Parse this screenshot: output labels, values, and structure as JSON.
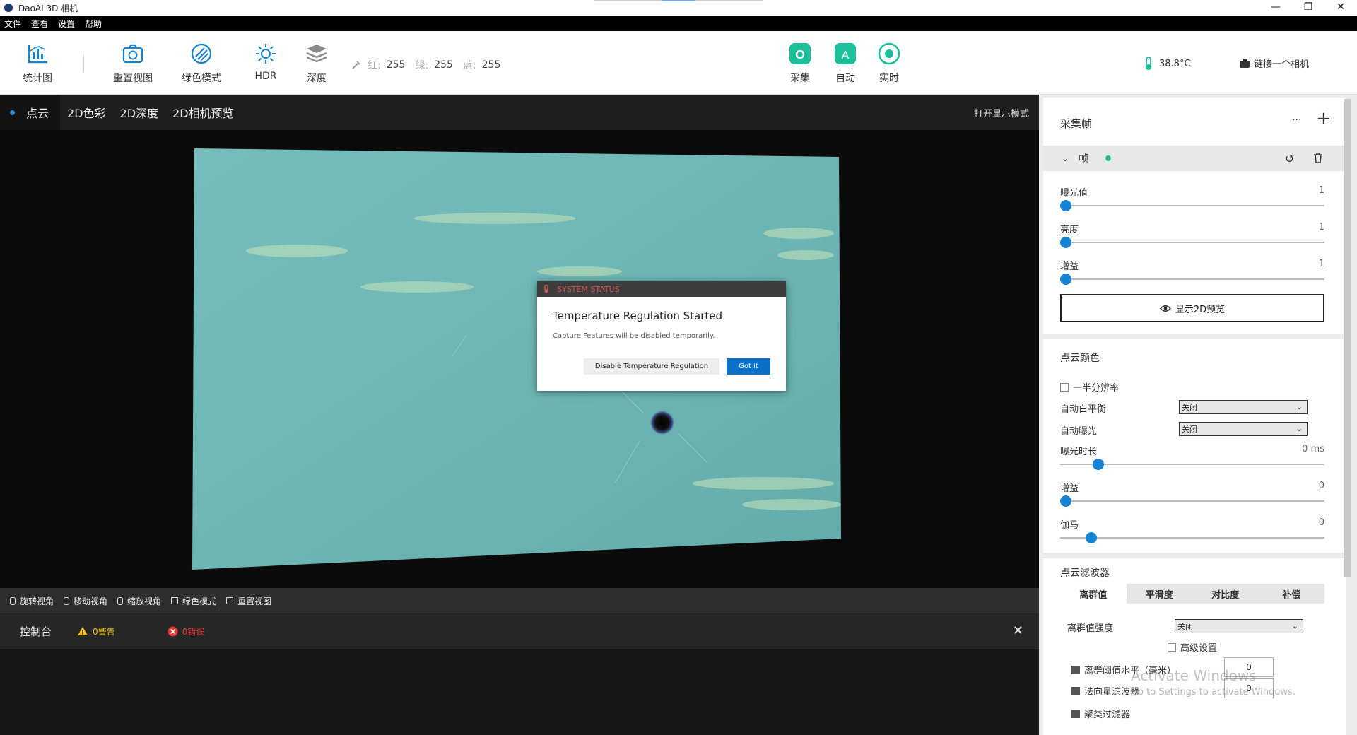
{
  "window": {
    "title": "DaoAI 3D 相机",
    "controls": [
      "—",
      "❐",
      "✕"
    ]
  },
  "menu": [
    "文件",
    "查看",
    "设置",
    "帮助"
  ],
  "toolbar": {
    "stats": "统计图",
    "reset_view": "重置视图",
    "green_mode": "绿色模式",
    "hdr": "HDR",
    "depth": "深度",
    "rgb": {
      "r_label": "红:",
      "r": "255",
      "g_label": "绿:",
      "g": "255",
      "b_label": "蓝:",
      "b": "255"
    },
    "capture": "采集",
    "auto": "自动",
    "auto_letter": "A",
    "realtime": "实时",
    "temperature": "38.8°C",
    "connect_camera": "链接一个相机",
    "accent": "#1bbf9a",
    "blue": "#1583d1"
  },
  "view": {
    "tabs": [
      "点云",
      "2D色彩",
      "2D深度",
      "2D相机预览"
    ],
    "open_display": "打开显示模式"
  },
  "dialog": {
    "header": "SYSTEM STATUS",
    "title": "Temperature Regulation Started",
    "message": "Capture Features will be disabled temporarily.",
    "secondary": "Disable Temperature Regulation",
    "primary": "Got it"
  },
  "hints": [
    "旋转视角",
    "移动视角",
    "缩放视角",
    "绿色模式",
    "重置视图"
  ],
  "console": {
    "title": "控制台",
    "warnings": "0警告",
    "errors": "0错误"
  },
  "panel": {
    "title": "采集帧",
    "more": "···",
    "add": "+",
    "frame_label": "帧",
    "exposure": {
      "label": "曝光值",
      "value": "1"
    },
    "brightness": {
      "label": "亮度",
      "value": "1"
    },
    "gain": {
      "label": "增益",
      "value": "1"
    },
    "preview_2d": "显示2D预览",
    "cloud_color": {
      "title": "点云颜色",
      "half_res": "一半分辨率",
      "auto_wb": "自动白平衡",
      "auto_wb_value": "关闭",
      "auto_exposure": "自动曝光",
      "auto_exposure_value": "关闭",
      "exposure_time": "曝光时长",
      "exposure_time_value": "0 ms",
      "gain": "增益",
      "gain_value": "0",
      "gamma": "伽马",
      "gamma_value": "0"
    },
    "filters": {
      "title": "点云滤波器",
      "tabs": [
        "离群值",
        "平滑度",
        "对比度",
        "补偿"
      ],
      "outlier_strength": "离群值强度",
      "outlier_strength_value": "关闭",
      "advanced": "高级设置",
      "outlier_threshold": "离群阈值水平（毫米）",
      "outlier_threshold_value": "0",
      "normal_filter": "法向量滤波器",
      "normal_filter_value": "0",
      "cluster_filter": "聚类过滤器"
    }
  },
  "watermark": {
    "line1": "Activate Windows",
    "line2": "Go to Settings to activate Windows."
  }
}
